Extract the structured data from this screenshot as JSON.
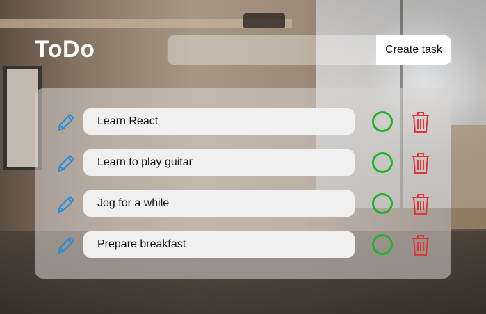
{
  "app": {
    "title": "ToDo"
  },
  "create": {
    "input_value": "",
    "placeholder": "",
    "button_label": "Create task"
  },
  "tasks": [
    {
      "label": "Learn React"
    },
    {
      "label": "Learn to play guitar"
    },
    {
      "label": "Jog for a while"
    },
    {
      "label": "Prepare breakfast"
    }
  ],
  "icons": {
    "edit": "pencil-icon",
    "complete": "circle-check-icon",
    "delete": "trash-icon"
  },
  "colors": {
    "edit": "#2a8ed8",
    "complete": "#1fb42a",
    "delete": "#e0363a"
  }
}
